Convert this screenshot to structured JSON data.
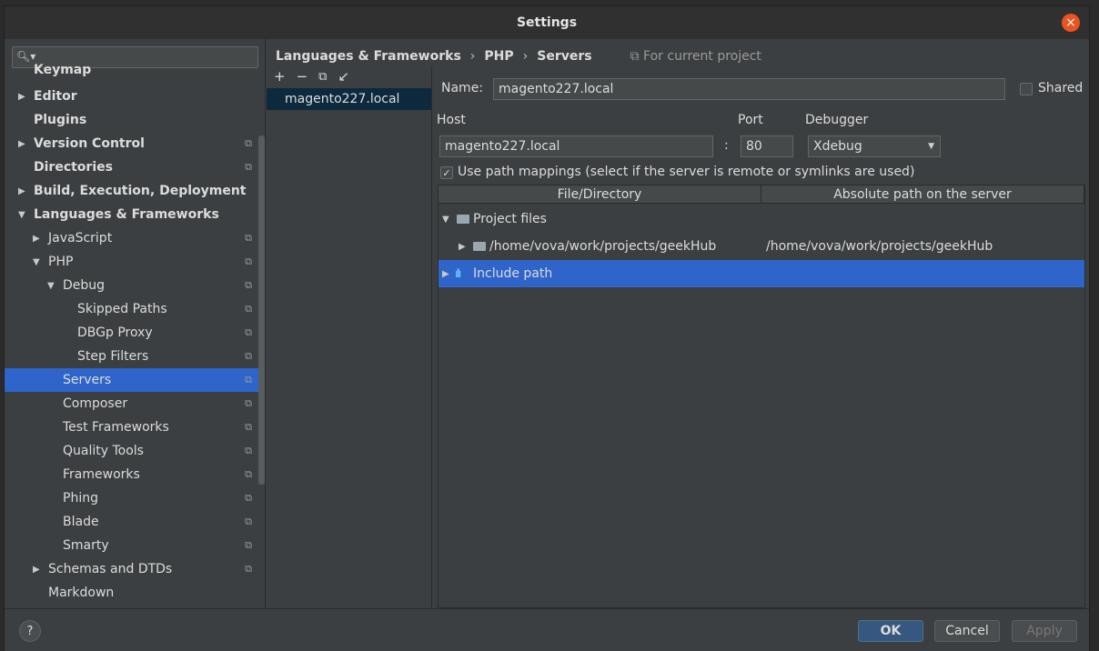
{
  "window": {
    "title": "Settings",
    "close_glyph": "×"
  },
  "search": {
    "placeholder": "",
    "icon": "search-icon"
  },
  "sidebar": {
    "items": [
      {
        "label": "Keymap",
        "indent": 0,
        "arrow": "",
        "bold": true,
        "proj": false
      },
      {
        "label": "Editor",
        "indent": 0,
        "arrow": "▶",
        "bold": true,
        "proj": false
      },
      {
        "label": "Plugins",
        "indent": 0,
        "arrow": "",
        "bold": true,
        "proj": false
      },
      {
        "label": "Version Control",
        "indent": 0,
        "arrow": "▶",
        "bold": true,
        "proj": true
      },
      {
        "label": "Directories",
        "indent": 0,
        "arrow": "",
        "bold": true,
        "proj": true
      },
      {
        "label": "Build, Execution, Deployment",
        "indent": 0,
        "arrow": "▶",
        "bold": true,
        "proj": false
      },
      {
        "label": "Languages & Frameworks",
        "indent": 0,
        "arrow": "▼",
        "bold": true,
        "proj": false
      },
      {
        "label": "JavaScript",
        "indent": 1,
        "arrow": "▶",
        "bold": false,
        "proj": true
      },
      {
        "label": "PHP",
        "indent": 1,
        "arrow": "▼",
        "bold": false,
        "proj": true
      },
      {
        "label": "Debug",
        "indent": 2,
        "arrow": "▼",
        "bold": false,
        "proj": true
      },
      {
        "label": "Skipped Paths",
        "indent": 3,
        "arrow": "",
        "bold": false,
        "proj": true
      },
      {
        "label": "DBGp Proxy",
        "indent": 3,
        "arrow": "",
        "bold": false,
        "proj": true
      },
      {
        "label": "Step Filters",
        "indent": 3,
        "arrow": "",
        "bold": false,
        "proj": true
      },
      {
        "label": "Servers",
        "indent": 2,
        "arrow": "",
        "bold": false,
        "proj": true,
        "selected": true
      },
      {
        "label": "Composer",
        "indent": 2,
        "arrow": "",
        "bold": false,
        "proj": true
      },
      {
        "label": "Test Frameworks",
        "indent": 2,
        "arrow": "",
        "bold": false,
        "proj": true
      },
      {
        "label": "Quality Tools",
        "indent": 2,
        "arrow": "",
        "bold": false,
        "proj": true
      },
      {
        "label": "Frameworks",
        "indent": 2,
        "arrow": "",
        "bold": false,
        "proj": true
      },
      {
        "label": "Phing",
        "indent": 2,
        "arrow": "",
        "bold": false,
        "proj": true
      },
      {
        "label": "Blade",
        "indent": 2,
        "arrow": "",
        "bold": false,
        "proj": true
      },
      {
        "label": "Smarty",
        "indent": 2,
        "arrow": "",
        "bold": false,
        "proj": true
      },
      {
        "label": "Schemas and DTDs",
        "indent": 1,
        "arrow": "▶",
        "bold": false,
        "proj": true
      },
      {
        "label": "Markdown",
        "indent": 1,
        "arrow": "",
        "bold": false,
        "proj": false
      }
    ],
    "proj_glyph": "⧉"
  },
  "breadcrumb": {
    "parts": [
      "Languages & Frameworks",
      "PHP",
      "Servers"
    ],
    "separator": "›",
    "scope_icon": "⧉",
    "scope_label": "For current project"
  },
  "server_list": {
    "toolbar": {
      "add": "+",
      "remove": "−",
      "copy": "⧉",
      "import": "↙"
    },
    "items": [
      "magento227.local"
    ]
  },
  "server_form": {
    "name_label": "Name:",
    "name_value": "magento227.local",
    "shared_label": "Shared",
    "shared_checked": false,
    "host_label": "Host",
    "host_value": "magento227.local",
    "port_sep": ":",
    "port_label": "Port",
    "port_value": "80",
    "debugger_label": "Debugger",
    "debugger_value": "Xdebug",
    "path_mappings_label": "Use path mappings (select if the server is remote or symlinks are used)",
    "path_mappings_checked": true,
    "check_glyph": "✓"
  },
  "mapping_table": {
    "columns": [
      "File/Directory",
      "Absolute path on the server"
    ],
    "rows": [
      {
        "name": "Project files",
        "arrow": "▼",
        "depth": 0,
        "icon": "folder-icon",
        "server_path": "",
        "selected": false
      },
      {
        "name": "/home/vova/work/projects/geekHub",
        "arrow": "▶",
        "depth": 1,
        "icon": "folder-icon",
        "server_path": "/home/vova/work/projects/geekHub",
        "selected": false
      },
      {
        "name": "Include path",
        "arrow": "▶",
        "depth": 0,
        "icon": "library-icon",
        "server_path": "",
        "selected": true
      }
    ],
    "library_glyph": "ıllı"
  },
  "footer": {
    "help": "?",
    "ok": "OK",
    "cancel": "Cancel",
    "apply": "Apply"
  },
  "colors": {
    "selection": "#2f65ca",
    "primary_button": "#365880",
    "close_button": "#e95420"
  }
}
